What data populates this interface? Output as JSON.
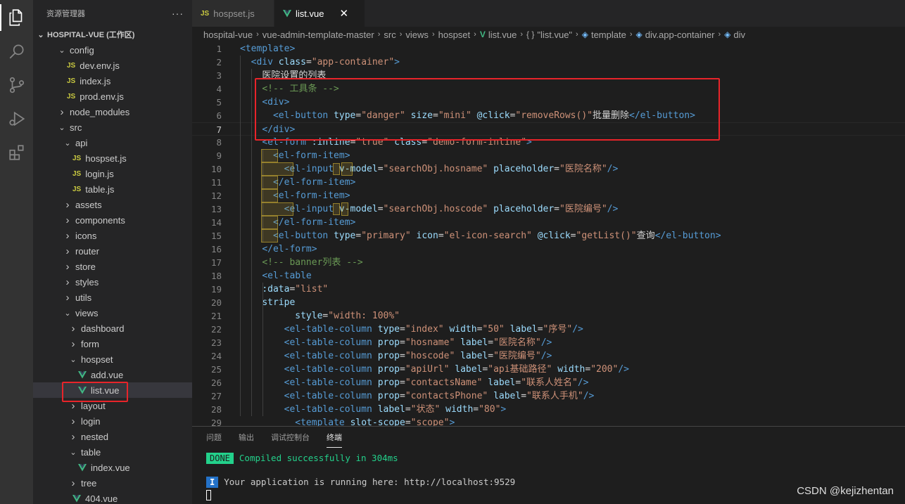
{
  "sidebar": {
    "title": "资源管理器",
    "more": "···",
    "workspace": "HOSPITAL-VUE (工作区)",
    "items": [
      {
        "label": "config",
        "type": "folder-open"
      },
      {
        "label": "dev.env.js",
        "type": "js"
      },
      {
        "label": "index.js",
        "type": "js"
      },
      {
        "label": "prod.env.js",
        "type": "js"
      },
      {
        "label": "node_modules",
        "type": "folder"
      },
      {
        "label": "src",
        "type": "folder-open"
      },
      {
        "label": "api",
        "type": "folder-open"
      },
      {
        "label": "hospset.js",
        "type": "js"
      },
      {
        "label": "login.js",
        "type": "js"
      },
      {
        "label": "table.js",
        "type": "js"
      },
      {
        "label": "assets",
        "type": "folder"
      },
      {
        "label": "components",
        "type": "folder"
      },
      {
        "label": "icons",
        "type": "folder"
      },
      {
        "label": "router",
        "type": "folder"
      },
      {
        "label": "store",
        "type": "folder"
      },
      {
        "label": "styles",
        "type": "folder"
      },
      {
        "label": "utils",
        "type": "folder"
      },
      {
        "label": "views",
        "type": "folder-open"
      },
      {
        "label": "dashboard",
        "type": "folder"
      },
      {
        "label": "form",
        "type": "folder"
      },
      {
        "label": "hospset",
        "type": "folder-open"
      },
      {
        "label": "add.vue",
        "type": "vue"
      },
      {
        "label": "list.vue",
        "type": "vue"
      },
      {
        "label": "layout",
        "type": "folder"
      },
      {
        "label": "login",
        "type": "folder"
      },
      {
        "label": "nested",
        "type": "folder"
      },
      {
        "label": "table",
        "type": "folder-open"
      },
      {
        "label": "index.vue",
        "type": "vue"
      },
      {
        "label": "tree",
        "type": "folder"
      },
      {
        "label": "404.vue",
        "type": "vue"
      }
    ]
  },
  "tabs": [
    {
      "label": "hospset.js",
      "type": "js"
    },
    {
      "label": "list.vue",
      "type": "vue",
      "close": "✕"
    }
  ],
  "breadcrumb": [
    "hospital-vue",
    "vue-admin-template-master",
    "src",
    "views",
    "hospset",
    "list.vue",
    "\"list.vue\"",
    "template",
    "div.app-container",
    "div"
  ],
  "breadcrumb_icons": {
    "list_vue": "V",
    "sfc": "{ }",
    "node": "◈"
  },
  "editor": {
    "line_numbers": [
      "1",
      "2",
      "3",
      "4",
      "5",
      "6",
      "7",
      "8",
      "9",
      "10",
      "11",
      "12",
      "13",
      "14",
      "15",
      "16",
      "17",
      "18",
      "19",
      "20",
      "21",
      "22",
      "23",
      "24",
      "25",
      "26",
      "27",
      "28",
      "29"
    ],
    "current_line": 7,
    "lines": [
      {
        "t1": "<template>"
      },
      {
        "t2": "<div",
        "a1": "class",
        "s1": "\"app-container\""
      },
      {
        "text": "医院设置的列表"
      },
      {
        "comment": "<!-- 工具条 -->"
      },
      {
        "tag": "<div>"
      },
      {
        "tag": "<el-button",
        "a1": "type",
        "s1": "\"danger\"",
        "a2": "size",
        "s2": "\"mini\"",
        "a3": "@click",
        "s3": "\"removeRows()\"",
        "text": "批量删除",
        "close": "</el-button>"
      },
      {
        "tag": "</div>"
      },
      {
        "tag": "<el-form",
        "a1": ":inline",
        "s1": "\"true\"",
        "a2": "class",
        "s2": "\"demo-form-inline\""
      },
      {
        "tag": "<el-form-item>"
      },
      {
        "tag": "<el-input",
        "a1": "v-model",
        "s1": "\"searchObj.hosname\"",
        "a2": "placeholder",
        "s2": "\"医院名称\""
      },
      {
        "tag": "</el-form-item>"
      },
      {
        "tag": "<el-form-item>"
      },
      {
        "tag": "<el-input",
        "a1": "v-model",
        "s1": "\"searchObj.hoscode\"",
        "a2": "placeholder",
        "s2": "\"医院编号\""
      },
      {
        "tag": "</el-form-item>"
      },
      {
        "tag": "<el-button",
        "a1": "type",
        "s1": "\"primary\"",
        "a2": "icon",
        "s2": "\"el-icon-search\"",
        "a3": "@click",
        "s3": "\"getList()\"",
        "text": "查询",
        "close": "</el-button>"
      },
      {
        "tag": "</el-form>"
      },
      {
        "comment": "<!-- banner列表 -->"
      },
      {
        "tag": "<el-table"
      },
      {
        "a1": ":data",
        "s1": "\"list\""
      },
      {
        "a1": "stripe"
      },
      {
        "a1": "style",
        "s1": "\"width: 100%\""
      },
      {
        "tag": "<el-table-column",
        "a1": "type",
        "s1": "\"index\"",
        "a2": "width",
        "s2": "\"50\"",
        "a3": "label",
        "s3": "\"序号\""
      },
      {
        "tag": "<el-table-column",
        "a1": "prop",
        "s1": "\"hosname\"",
        "a2": "label",
        "s2": "\"医院名称\""
      },
      {
        "tag": "<el-table-column",
        "a1": "prop",
        "s1": "\"hoscode\"",
        "a2": "label",
        "s2": "\"医院编号\""
      },
      {
        "tag": "<el-table-column",
        "a1": "prop",
        "s1": "\"apiUrl\"",
        "a2": "label",
        "s2": "\"api基础路径\"",
        "a3": "width",
        "s3": "\"200\""
      },
      {
        "tag": "<el-table-column",
        "a1": "prop",
        "s1": "\"contactsName\"",
        "a2": "label",
        "s2": "\"联系人姓名\""
      },
      {
        "tag": "<el-table-column",
        "a1": "prop",
        "s1": "\"contactsPhone\"",
        "a2": "label",
        "s2": "\"联系人手机\""
      },
      {
        "tag": "<el-table-column",
        "a1": "label",
        "s1": "\"状态\"",
        "a2": "width",
        "s2": "\"80\""
      },
      {
        "tag": "<template",
        "a1": "slot-scope",
        "s1": "\"scope\""
      }
    ]
  },
  "panel": {
    "tabs": [
      "问题",
      "输出",
      "调试控制台",
      "终端"
    ],
    "active_tab": "终端",
    "done_badge": "DONE",
    "done_text": "Compiled successfully in 304ms",
    "info_badge": "I",
    "info_text": "Your application is running here: http://localhost:9529"
  },
  "watermark": "CSDN @kejizhentan",
  "colors": {
    "accent_red": "#e8242a",
    "js_yellow": "#cbcb41",
    "vue_green": "#41b883"
  }
}
